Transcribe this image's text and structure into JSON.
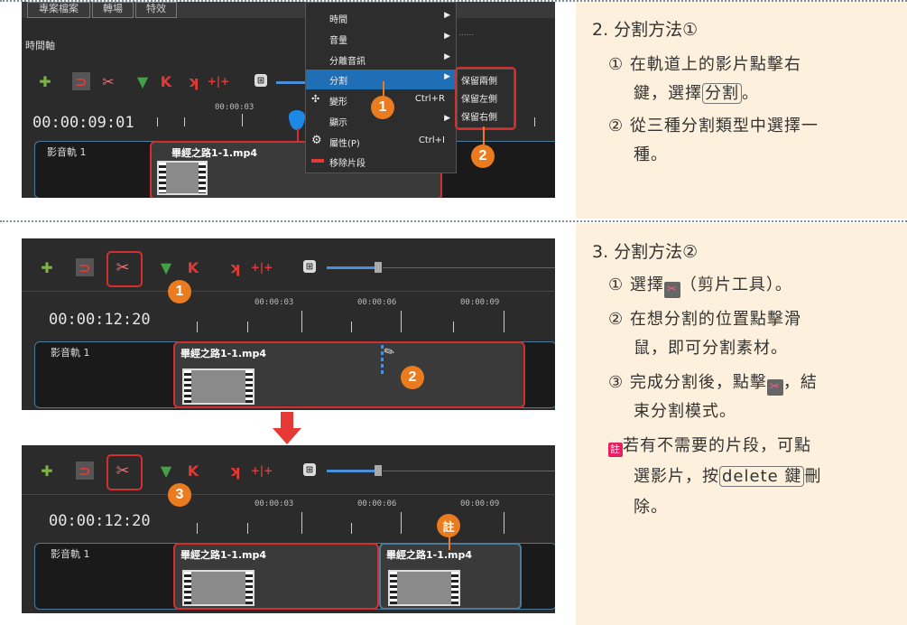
{
  "colors": {
    "accent_orange": "#ea7b1e",
    "highlight_red": "#d32f2f",
    "panel_bg": "#fdf0dc",
    "app_bg": "#2b2b2b"
  },
  "top_app": {
    "tabs": [
      "專案檔案",
      "轉場",
      "特效"
    ],
    "timeline_label": "時間軸",
    "timecode": "00:00:09:01",
    "ruler_mark": "00:00:03",
    "track_name": "影音軌 1",
    "clip_title": "畢經之路1-1.mp4",
    "context_menu": [
      {
        "label": "時間",
        "shortcut": "",
        "submenu": true
      },
      {
        "label": "音量",
        "shortcut": "",
        "submenu": true
      },
      {
        "label": "分離音訊",
        "shortcut": "",
        "submenu": true
      },
      {
        "label": "分割",
        "shortcut": "",
        "submenu": true
      },
      {
        "label": "變形",
        "shortcut": "Ctrl+R",
        "submenu": false
      },
      {
        "label": "顯示",
        "shortcut": "",
        "submenu": true
      },
      {
        "label": "屬性(P)",
        "shortcut": "Ctrl+I",
        "submenu": false
      },
      {
        "label": "移除片段",
        "shortcut": "",
        "submenu": false
      }
    ],
    "split_submenu": [
      "保留兩側",
      "保留左側",
      "保留右側"
    ],
    "badge1": "1",
    "badge2": "2"
  },
  "mid_app": {
    "timecode": "00:00:12:20",
    "ruler": [
      "00:00:03",
      "00:00:06",
      "00:00:09"
    ],
    "track_name": "影音軌 1",
    "clip_title": "畢經之路1-1.mp4",
    "badge1": "1",
    "badge2": "2"
  },
  "bottom_app": {
    "timecode": "00:00:12:20",
    "ruler": [
      "00:00:03",
      "00:00:06",
      "00:00:09"
    ],
    "track_name": "影音軌 1",
    "clip_left_title": "畢經之路1-1.mp4",
    "clip_right_title": "畢經之路1-1.mp4",
    "badge3": "3",
    "note_badge": "註"
  },
  "instructions": {
    "s2_title": "2. 分割方法①",
    "s2_step1_a": "① 在軌道上的影片點擊右",
    "s2_step1_b_pre": "鍵，選擇",
    "s2_step1_b_boxed": "分割",
    "s2_step1_b_post": "。",
    "s2_step2_a": "② 從三種分割類型中選擇一",
    "s2_step2_b": "種。",
    "s3_title": "3. 分割方法②",
    "s3_step1_pre": "① 選擇",
    "s3_step1_post": "（剪片工具）。",
    "s3_step2_a": "② 在想分割的位置點擊滑",
    "s3_step2_b": "鼠，即可分割素材。",
    "s3_step3_pre": "③ 完成分割後，點擊",
    "s3_step3_post": "，結",
    "s3_step3_b": "束分割模式。",
    "note_icon": "註",
    "note_a": "若有不需要的片段，可點",
    "note_b_pre": "選影片，按",
    "note_b_boxed": "delete 鍵",
    "note_b_post": "刪",
    "note_c": "除。"
  }
}
